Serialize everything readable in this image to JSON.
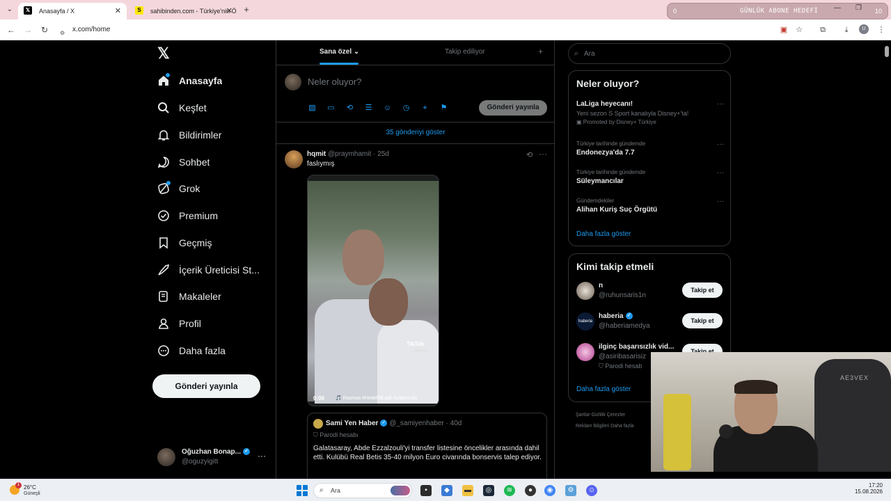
{
  "browser": {
    "tabs": [
      {
        "title": "Anasayfa / X",
        "favicon": "x-logo-icon"
      },
      {
        "title": "sahibinden.com - Türkiye'nin Ö",
        "favicon": "sahibinden-icon"
      }
    ],
    "overlay": {
      "left_value": "0",
      "label": "GÜNLÜK ABONE HEDEFİ",
      "right_value": "10"
    },
    "url": "x.com/home"
  },
  "nav": {
    "items": [
      {
        "label": "Anasayfa",
        "icon": "home-icon"
      },
      {
        "label": "Keşfet",
        "icon": "search-icon"
      },
      {
        "label": "Bildirimler",
        "icon": "bell-icon"
      },
      {
        "label": "Sohbet",
        "icon": "chat-icon"
      },
      {
        "label": "Grok",
        "icon": "grok-icon"
      },
      {
        "label": "Premium",
        "icon": "premium-icon"
      },
      {
        "label": "Geçmiş",
        "icon": "bookmark-icon"
      },
      {
        "label": "İçerik Üreticisi St...",
        "icon": "rocket-icon"
      },
      {
        "label": "Makaleler",
        "icon": "article-icon"
      },
      {
        "label": "Profil",
        "icon": "person-icon"
      },
      {
        "label": "Daha fazla",
        "icon": "more-circle-icon"
      }
    ],
    "post_button": "Gönderi yayınla",
    "account": {
      "name": "Oğuzhan Bonap...",
      "handle": "@oguzyigitt"
    }
  },
  "main": {
    "tabs": [
      {
        "label": "Sana özel"
      },
      {
        "label": "Takip ediliyor"
      }
    ],
    "compose": {
      "placeholder": "Neler oluyor?",
      "post_button": "Gönderi yayınla"
    },
    "show_more": "35 gönderiyi göster",
    "tweet": {
      "name": "hqmit",
      "handle": "@praymhamit",
      "time": "25d",
      "text": "faslıymış",
      "video": {
        "watermark": "TikTok",
        "watermark_handle": "@enver...7",
        "duration": "0:06",
        "caption": "🎵 Rasmus #Hedef28 adlı kullanıcıda"
      },
      "quote": {
        "name": "Sami Yen Haber",
        "handle": "@_samiyenhaber",
        "time": "40d",
        "badge": "Parodi hesabı",
        "text": "Galatasaray, Abde Ezzalzouli'yi transfer listesine öncelikler arasında dahil etti. Kulübü Real Betis 35-40 milyon Euro civarında bonservis talep ediyor."
      }
    }
  },
  "right": {
    "search_placeholder": "Ara",
    "trends_title": "Neler oluyor?",
    "trends": [
      {
        "context": "",
        "title": "LaLiga heyecanı!",
        "sub": "Yeni sezon S Sport kanalıyla Disney+'ta!",
        "promo": "Promoted by Disney+ Türkiye"
      },
      {
        "context": "Türkiye tarihinde gündemde",
        "title": "Endonezya'da 7.7"
      },
      {
        "context": "Türkiye tarihinde gündemde",
        "title": "Süleymancılar"
      },
      {
        "context": "Gündemdekiler",
        "title": "Alihan Kuriş Suç Örgütü"
      }
    ],
    "trends_more": "Daha fazla göster",
    "who_title": "Kimi takip etmeli",
    "who": [
      {
        "name": "n",
        "handle": "@ruhunsaris1n",
        "button": "Takip et"
      },
      {
        "name": "haberia",
        "handle": "@haberiamedya",
        "button": "Takip et"
      },
      {
        "name": "ilginç başarısızlık vid...",
        "handle": "@asiribasarisiz",
        "sub": "Parodi hesab",
        "button": "Takip et"
      }
    ],
    "who_more": "Daha fazla göster",
    "footer1": "Şartlar   Gizlilik   Çerezler",
    "footer2": "Reklam Bilgileri   Daha fazla"
  },
  "cam": {
    "chair_brand": "AE3VEX"
  },
  "taskbar": {
    "weather_temp": "26°C",
    "weather_cond": "Güneşli",
    "weather_badge": "1",
    "search": "Ara",
    "time": "17:20",
    "date": "15.08.2026"
  },
  "colors": {
    "accent": "#1d9bf0",
    "background": "#000000",
    "tabbar": "#f4d7dc"
  }
}
